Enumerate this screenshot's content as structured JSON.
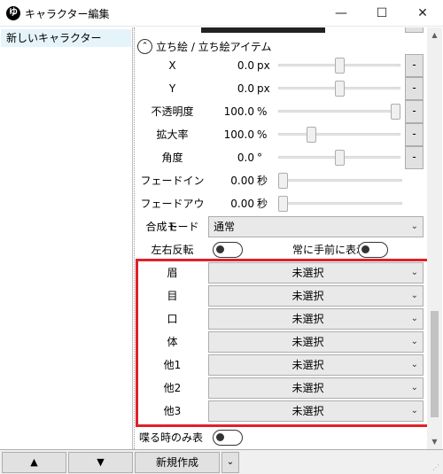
{
  "window": {
    "title": "キャラクター編集",
    "app_icon": "ゆ",
    "min": "—",
    "max": "☐",
    "close": "✕"
  },
  "character_list": {
    "items": [
      "新しいキャラクター"
    ]
  },
  "section": {
    "title": "立ち絵 / 立ち絵アイテム",
    "collapse_icon": "⌃"
  },
  "sliders": [
    {
      "label": "X",
      "value": "0.0",
      "unit": "px",
      "level": 0.5,
      "minus": "-"
    },
    {
      "label": "Y",
      "value": "0.0",
      "unit": "px",
      "level": 0.5,
      "minus": "-"
    },
    {
      "label": "不透明度",
      "value": "100.0",
      "unit": "%",
      "level": 1.0,
      "minus": "-"
    },
    {
      "label": "拡大率",
      "value": "100.0",
      "unit": "%",
      "level": 0.25,
      "minus": "-"
    },
    {
      "label": "角度",
      "value": "0.0",
      "unit": "°",
      "level": 0.5,
      "minus": "-"
    },
    {
      "label": "フェードイン",
      "value": "0.00",
      "unit": "秒",
      "level": 0.0
    },
    {
      "label": "フェードアウト",
      "value": "0.00",
      "unit": "秒",
      "level": 0.0
    }
  ],
  "blend_mode": {
    "label": "合成モード",
    "value": "通常"
  },
  "toggles": {
    "flip_label": "左右反転",
    "front_label": "常に手前に表示",
    "speak_only_label": "喋る時のみ表示"
  },
  "parts": [
    {
      "label": "眉",
      "value": "未選択"
    },
    {
      "label": "目",
      "value": "未選択"
    },
    {
      "label": "口",
      "value": "未選択"
    },
    {
      "label": "体",
      "value": "未選択"
    },
    {
      "label": "他1",
      "value": "未選択"
    },
    {
      "label": "他2",
      "value": "未選択"
    },
    {
      "label": "他3",
      "value": "未選択"
    }
  ],
  "bottom": {
    "up_label": "▲",
    "down_label": "▼",
    "new_label": "新規作成",
    "dropdown_icon": "⌄"
  },
  "colors": {
    "highlight": "#e0202a"
  }
}
